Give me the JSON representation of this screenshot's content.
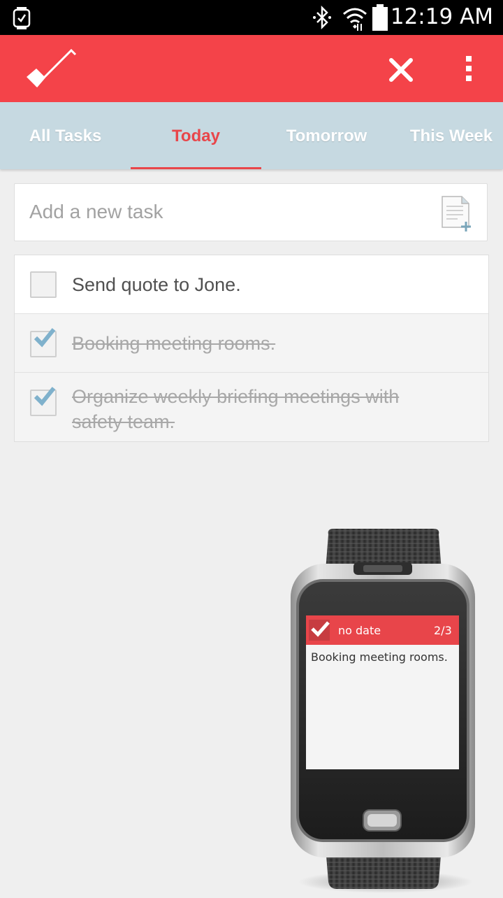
{
  "status_bar": {
    "time": "12:19 AM",
    "icons": [
      "watch-notification-icon",
      "bluetooth-icon",
      "wifi-icon",
      "battery-icon"
    ]
  },
  "app_bar": {
    "logo": "checkmark-logo",
    "actions": [
      "close-icon",
      "more-options-icon"
    ],
    "accent_color": "#f44349"
  },
  "tabs": [
    {
      "label": "All Tasks",
      "active": false
    },
    {
      "label": "Today",
      "active": true
    },
    {
      "label": "Tomorrow",
      "active": false
    },
    {
      "label": "This Week",
      "active": false
    }
  ],
  "add_task": {
    "placeholder": "Add a new task",
    "icon": "add-note-icon"
  },
  "tasks": [
    {
      "text": "Send quote to Jone.",
      "done": false
    },
    {
      "text": "Booking meeting rooms.",
      "done": true
    },
    {
      "text_line1": "Organize weekly briefing meetings with",
      "text_line2": "safety team.",
      "done": true
    }
  ],
  "watch": {
    "header": "no date",
    "counter": "2/3",
    "body": "Booking meeting rooms."
  }
}
